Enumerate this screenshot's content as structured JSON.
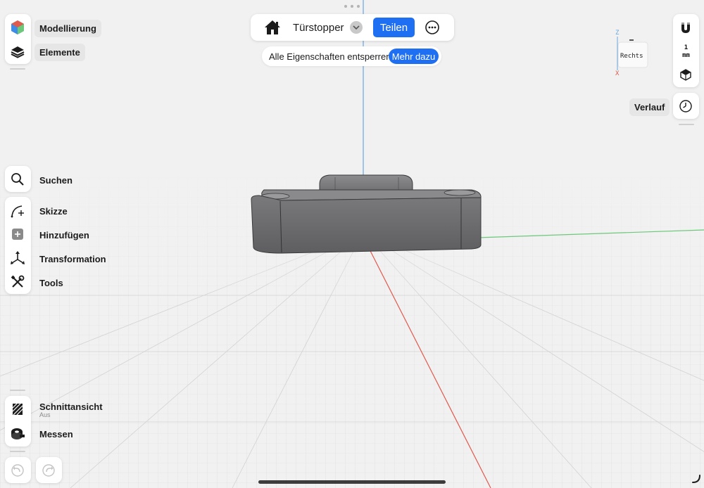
{
  "toolbar": {
    "modelling_label": "Modellierung",
    "elements_label": "Elemente",
    "search_label": "Suchen",
    "sketch_label": "Skizze",
    "add_label": "Hinzufügen",
    "transform_label": "Transformation",
    "tools_label": "Tools",
    "section_label": "Schnittansicht",
    "section_sub": "Aus",
    "measure_label": "Messen"
  },
  "header": {
    "document_title": "Türstopper",
    "share_label": "Teilen"
  },
  "banner": {
    "text": "Alle Eigenschaften entsperren",
    "button_label": "Mehr dazu"
  },
  "view_cube": {
    "face_label": "Rechts",
    "axis_z": "Z",
    "axis_x": "X"
  },
  "right_panel": {
    "unit_value": "1",
    "unit_label": "mm",
    "history_label": "Verlauf"
  },
  "colors": {
    "accent": "#1f6ff2",
    "background": "#f1f1f1",
    "model": "#707073",
    "axis_x": "#e05a4e",
    "axis_y": "#6cc87a",
    "axis_z": "#6aa6e0"
  },
  "icons": [
    "modelling-icon",
    "layers-icon",
    "search-icon",
    "sketch-icon",
    "add-icon",
    "transform-icon",
    "tools-icon",
    "section-icon",
    "measure-icon",
    "undo-icon",
    "redo-icon",
    "home-icon",
    "chevron-down-icon",
    "more-icon",
    "magnet-icon",
    "ruler-cube-icon",
    "history-icon"
  ]
}
